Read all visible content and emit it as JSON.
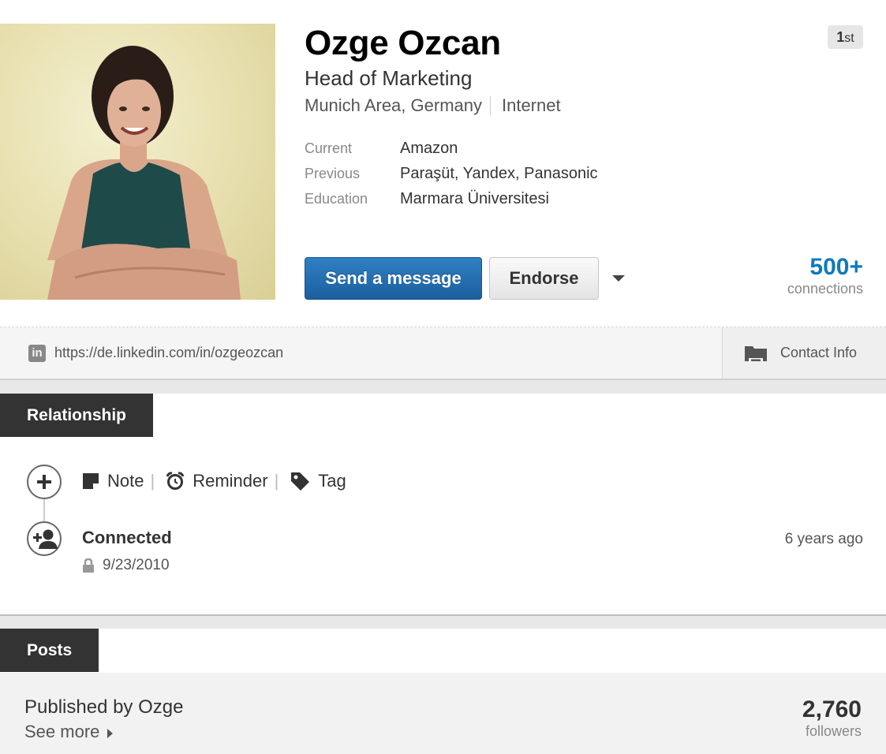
{
  "profile": {
    "name": "Ozge Ozcan",
    "headline": "Head of Marketing",
    "location": "Munich Area, Germany",
    "industry": "Internet",
    "degree": "1",
    "degree_suffix": "st",
    "overview": [
      {
        "label": "Current",
        "value": "Amazon"
      },
      {
        "label": "Previous",
        "value": "Paraşüt, Yandex, Panasonic"
      },
      {
        "label": "Education",
        "value": "Marmara Üniversitesi"
      }
    ],
    "send_message_label": "Send a message",
    "endorse_label": "Endorse",
    "connections_count": "500+",
    "connections_label": "connections",
    "public_url": "https://de.linkedin.com/in/ozgeozcan",
    "linkedin_icon_letters": "in",
    "contact_info_label": "Contact Info"
  },
  "relationship": {
    "section_title": "Relationship",
    "actions": {
      "note": "Note",
      "reminder": "Reminder",
      "tag": "Tag"
    },
    "connected_title": "Connected",
    "connected_ago": "6 years ago",
    "connected_date": "9/23/2010"
  },
  "posts": {
    "section_title": "Posts",
    "published_by": "Published by Ozge",
    "see_more": "See more",
    "followers_count": "2,760",
    "followers_label": "followers"
  },
  "colors": {
    "primary_button": "#1c5f9e",
    "connections_accent": "#0e7bbd",
    "section_tab": "#333333"
  }
}
